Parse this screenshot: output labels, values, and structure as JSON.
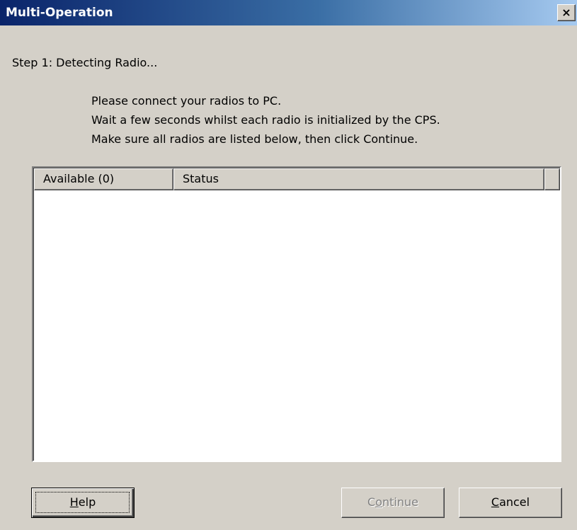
{
  "window": {
    "title": "Multi-Operation",
    "close_glyph": "×"
  },
  "step": {
    "label": "Step 1: Detecting Radio..."
  },
  "instructions": [
    "Please connect your radios to PC.",
    "Wait a few seconds whilst each radio is initialized by the CPS.",
    "Make sure all radios are listed below, then click Continue."
  ],
  "list": {
    "columns": [
      "Available (0)",
      "Status"
    ],
    "rows": []
  },
  "buttons": {
    "help": {
      "pre": "",
      "mnemonic": "H",
      "post": "elp",
      "enabled": true
    },
    "continue": {
      "pre": "C",
      "mnemonic": "o",
      "post": "ntinue",
      "enabled": false
    },
    "cancel": {
      "pre": "",
      "mnemonic": "C",
      "post": "ancel",
      "enabled": true
    }
  },
  "colors": {
    "titlebar_start": "#0a246a",
    "titlebar_end": "#a6caf0",
    "face": "#d4d0c8",
    "disabled_text": "#808080"
  }
}
